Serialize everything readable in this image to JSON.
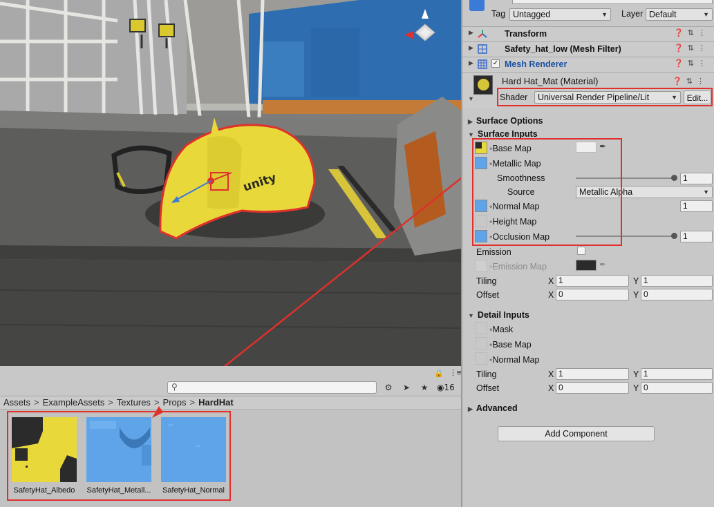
{
  "scene": {
    "logo_text": "unity"
  },
  "project": {
    "hidden_count": "16",
    "breadcrumb": [
      "Assets",
      "ExampleAssets",
      "Textures",
      "Props"
    ],
    "breadcrumb_current": "HardHat",
    "assets": [
      {
        "name": "SafetyHat_Albedo"
      },
      {
        "name": "SafetyHat_Metall..."
      },
      {
        "name": "SafetyHat_Normal"
      }
    ]
  },
  "inspector": {
    "tag_label": "Tag",
    "tag_value": "Untagged",
    "layer_label": "Layer",
    "layer_value": "Default",
    "components": [
      {
        "name": "Transform",
        "icon": "transform-icon"
      },
      {
        "name": "Safety_hat_low (Mesh Filter)",
        "icon": "mesh-filter-icon"
      },
      {
        "name": "Mesh Renderer",
        "icon": "mesh-renderer-icon"
      }
    ],
    "material": {
      "title": "Hard Hat_Mat (Material)",
      "shader_label": "Shader",
      "shader_value": "Universal Render Pipeline/Lit",
      "edit_label": "Edit..."
    },
    "surface_options": "Surface Options",
    "surface_inputs": "Surface Inputs",
    "base_map": "Base Map",
    "metallic_map": "Metallic Map",
    "smoothness": "Smoothness",
    "smoothness_value": "1",
    "source": "Source",
    "source_value": "Metallic Alpha",
    "normal_map": "Normal Map",
    "normal_value": "1",
    "height_map": "Height Map",
    "occlusion_map": "Occlusion Map",
    "occlusion_value": "1",
    "emission": "Emission",
    "emission_map": "Emission Map",
    "tiling": "Tiling",
    "offset": "Offset",
    "tiling_x": "1",
    "tiling_y": "1",
    "offset_x": "0",
    "offset_y": "0",
    "detail_inputs": "Detail Inputs",
    "mask": "Mask",
    "detail_base_map": "Base Map",
    "detail_normal_map": "Normal Map",
    "detail_tiling_x": "1",
    "detail_tiling_y": "1",
    "detail_offset_x": "0",
    "detail_offset_y": "0",
    "advanced": "Advanced",
    "add_component": "Add Component",
    "x_label": "X",
    "y_label": "Y",
    "smoothness_level": 1.0,
    "occlusion_level": 1.0
  },
  "colors": {
    "highlight": "#e0302c",
    "hat_yellow": "#e8d83a",
    "normal_blue": "#5fa3e8"
  }
}
